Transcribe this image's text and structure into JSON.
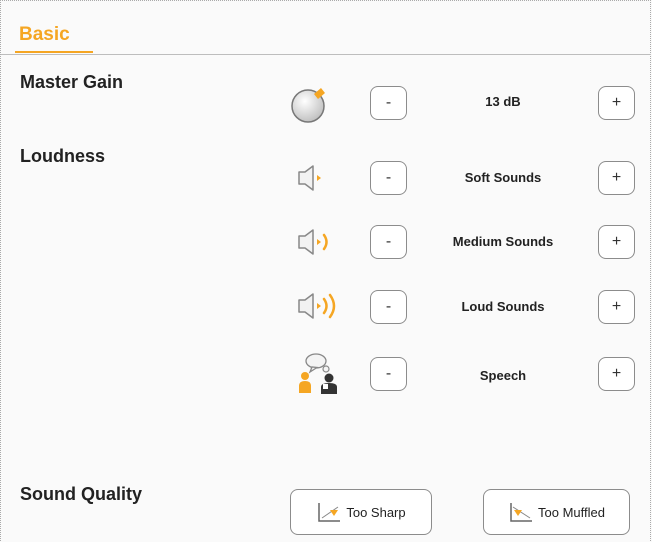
{
  "tabs": [
    {
      "label": "Basic",
      "active": true
    }
  ],
  "sections": {
    "master_gain": "Master Gain",
    "loudness": "Loudness",
    "sound_quality": "Sound Quality"
  },
  "controls": {
    "master_gain": {
      "minus": "-",
      "value": "13 dB",
      "plus": "+",
      "icon": "dial-icon"
    },
    "soft": {
      "minus": "-",
      "value": "Soft Sounds",
      "plus": "+",
      "icon": "speaker-soft-icon"
    },
    "medium": {
      "minus": "-",
      "value": "Medium Sounds",
      "plus": "+",
      "icon": "speaker-medium-icon"
    },
    "loud": {
      "minus": "-",
      "value": "Loud Sounds",
      "plus": "+",
      "icon": "speaker-loud-icon"
    },
    "speech": {
      "minus": "-",
      "value": "Speech",
      "plus": "+",
      "icon": "speech-people-icon"
    }
  },
  "quality_buttons": {
    "too_sharp": "Too Sharp",
    "too_muffled": "Too Muffled"
  },
  "colors": {
    "accent": "#f5a623",
    "border": "#8c8c8c"
  }
}
